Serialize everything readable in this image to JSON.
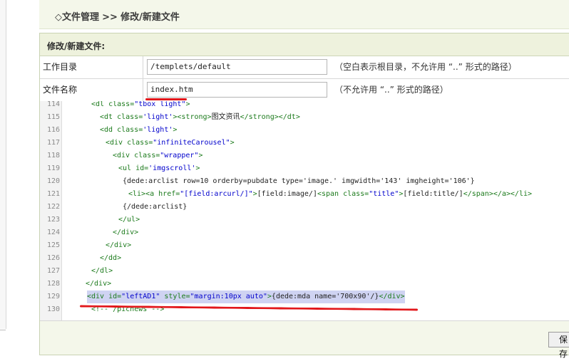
{
  "breadcrumb": {
    "prefix": "◇",
    "section": "文件管理",
    "separator": ">>",
    "current": "修改/新建文件"
  },
  "panel": {
    "title": "修改/新建文件:"
  },
  "fields": {
    "workdir": {
      "label": "工作目录",
      "value": "/templets/default",
      "hint": "（空白表示根目录，不允许用 “..” 形式的路径）"
    },
    "filename": {
      "label": "文件名称",
      "value": "index.htm",
      "hint": "（不允许用 “..” 形式的路径）"
    }
  },
  "editor": {
    "lines": [
      {
        "n": "114",
        "parts": [
          [
            "tag",
            "<dl "
          ],
          [
            "attr",
            "class="
          ],
          [
            "val",
            "\"tbox light\""
          ],
          [
            "tag",
            ">"
          ]
        ]
      },
      {
        "n": "115",
        "parts": [
          [
            "tag",
            "<dt "
          ],
          [
            "attr",
            "class="
          ],
          [
            "val",
            "'light'"
          ],
          [
            "tag",
            "><strong>"
          ],
          [
            "txt",
            "图文资讯"
          ],
          [
            "tag",
            "</strong></dt>"
          ]
        ]
      },
      {
        "n": "116",
        "parts": [
          [
            "tag",
            "<dd "
          ],
          [
            "attr",
            "class="
          ],
          [
            "val",
            "'light'"
          ],
          [
            "tag",
            ">"
          ]
        ]
      },
      {
        "n": "117",
        "parts": [
          [
            "tag",
            "<div "
          ],
          [
            "attr",
            "class="
          ],
          [
            "val",
            "\"infiniteCarousel\""
          ],
          [
            "tag",
            ">"
          ]
        ]
      },
      {
        "n": "118",
        "parts": [
          [
            "tag",
            "<div "
          ],
          [
            "attr",
            "class="
          ],
          [
            "val",
            "\"wrapper\""
          ],
          [
            "tag",
            ">"
          ]
        ]
      },
      {
        "n": "119",
        "parts": [
          [
            "tag",
            "<ul "
          ],
          [
            "attr",
            "id="
          ],
          [
            "val",
            "'imgscroll'"
          ],
          [
            "tag",
            ">"
          ]
        ]
      },
      {
        "n": "120",
        "parts": [
          [
            "txt",
            "{dede:arclist row=10 orderby=pubdate type='image.' imgwidth='143' imgheight='106'}"
          ]
        ]
      },
      {
        "n": "121",
        "parts": [
          [
            "tag",
            "<li><a "
          ],
          [
            "attr",
            "href="
          ],
          [
            "val",
            "\"[field:arcurl/]\""
          ],
          [
            "tag",
            ">"
          ],
          [
            "txt",
            "[field:image/]"
          ],
          [
            "tag",
            "<span "
          ],
          [
            "attr",
            "class="
          ],
          [
            "val",
            "\"title\""
          ],
          [
            "tag",
            ">"
          ],
          [
            "txt",
            "[field:title/]"
          ],
          [
            "tag",
            "</span></a></li>"
          ]
        ]
      },
      {
        "n": "122",
        "parts": [
          [
            "txt",
            "{/dede:arclist}"
          ]
        ]
      },
      {
        "n": "123",
        "parts": [
          [
            "tag",
            "</ul>"
          ]
        ]
      },
      {
        "n": "124",
        "parts": [
          [
            "tag",
            "</div>"
          ]
        ]
      },
      {
        "n": "125",
        "parts": [
          [
            "tag",
            "</div>"
          ]
        ]
      },
      {
        "n": "126",
        "parts": [
          [
            "tag",
            "</dd>"
          ]
        ]
      },
      {
        "n": "127",
        "parts": [
          [
            "tag",
            "</dl>"
          ]
        ]
      },
      {
        "n": "128",
        "parts": [
          [
            "tag",
            "</div>"
          ]
        ]
      },
      {
        "n": "129",
        "parts": [
          [
            "tag",
            "<div "
          ],
          [
            "attr",
            "id="
          ],
          [
            "val",
            "\"leftAD1\""
          ],
          [
            "attr",
            " style="
          ],
          [
            "val",
            "\"margin:10px auto\""
          ],
          [
            "tag",
            ">"
          ],
          [
            "txt",
            "{dede:mda name='700x90'/}"
          ],
          [
            "tag",
            "</div>"
          ]
        ]
      },
      {
        "n": "130",
        "parts": [
          [
            "tag",
            "<!-- /picnews -->"
          ]
        ]
      }
    ],
    "highlighted_line": "129"
  },
  "footer": {
    "save_label": "保存"
  },
  "colors": {
    "annotation_red": "#e2171b",
    "highlight": "#cfd3f2",
    "header_bg": "#eef2dd"
  }
}
